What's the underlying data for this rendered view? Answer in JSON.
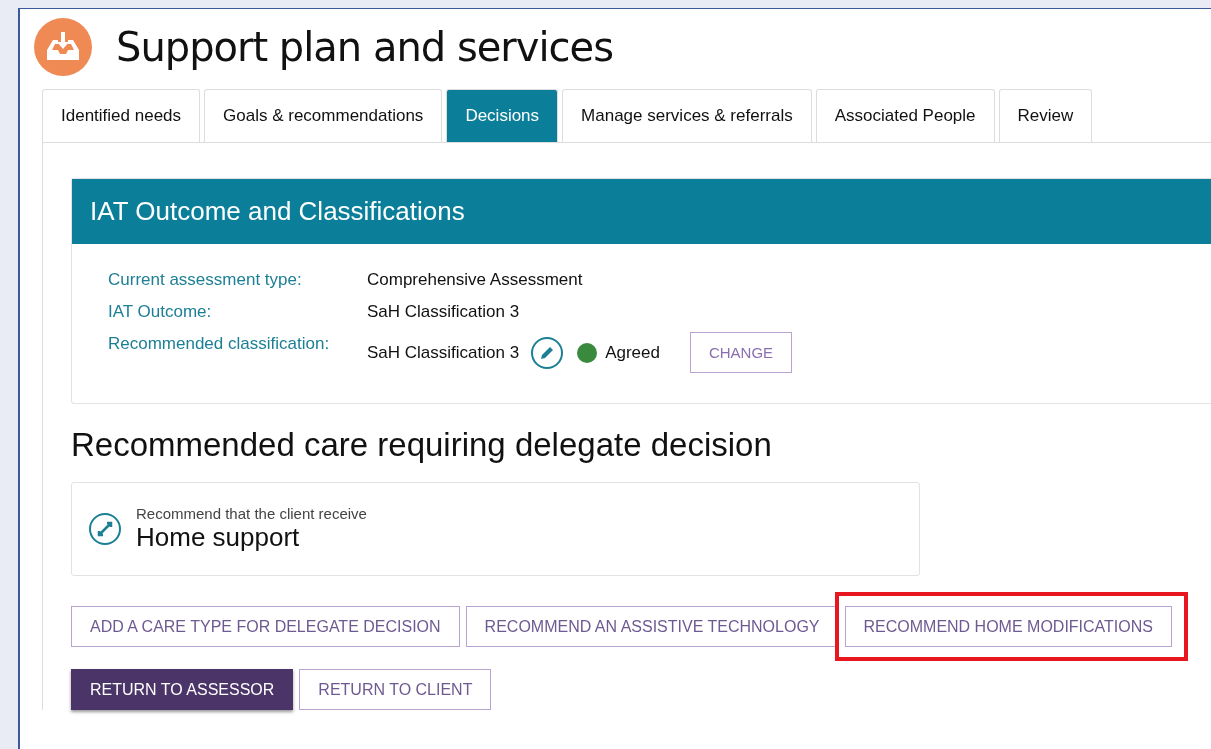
{
  "page": {
    "title": "Support plan and services"
  },
  "tabs": [
    {
      "label": "Identified needs",
      "selected": false
    },
    {
      "label": "Goals & recommendations",
      "selected": false
    },
    {
      "label": "Decisions",
      "selected": true
    },
    {
      "label": "Manage services & referrals",
      "selected": false
    },
    {
      "label": "Associated People",
      "selected": false
    },
    {
      "label": "Review",
      "selected": false
    }
  ],
  "outcome_card": {
    "title": "IAT Outcome and Classifications",
    "fields": [
      {
        "label": "Current assessment type:",
        "value": "Comprehensive Assessment"
      },
      {
        "label": "IAT Outcome:",
        "value": "SaH Classification 3"
      },
      {
        "label": "Recommended classification:",
        "value": "SaH Classification 3",
        "status": {
          "label": "Agreed",
          "color": "#3a8a3e"
        },
        "action": "CHANGE"
      }
    ]
  },
  "section_heading": "Recommended care requiring delegate decision",
  "care_card": {
    "caption": "Recommend that the client receive",
    "title": "Home support"
  },
  "action_buttons": [
    {
      "label": "ADD A CARE TYPE FOR DELEGATE DECISION",
      "highlighted": false
    },
    {
      "label": "RECOMMEND AN ASSISTIVE TECHNOLOGY",
      "highlighted": false
    },
    {
      "label": "RECOMMEND HOME MODIFICATIONS",
      "highlighted": true
    }
  ],
  "footer_buttons": [
    {
      "label": "RETURN TO ASSESSOR",
      "kind": "primary"
    },
    {
      "label": "RETURN TO CLIENT",
      "kind": "outline"
    }
  ]
}
